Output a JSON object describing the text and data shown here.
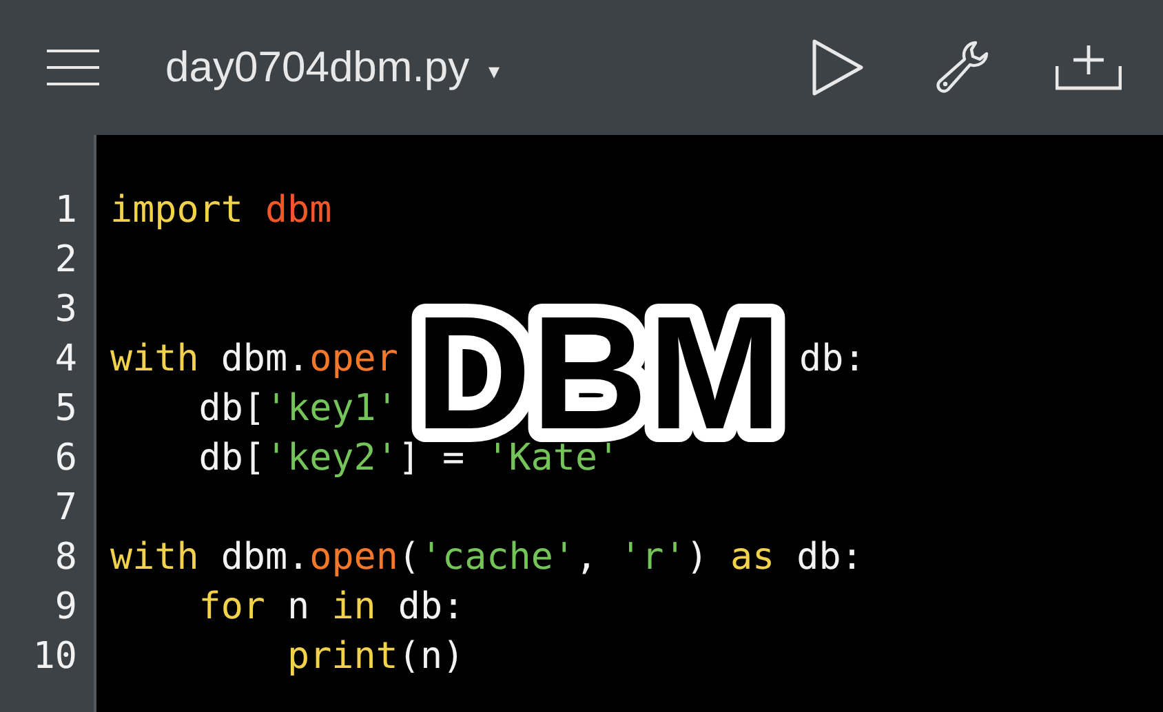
{
  "toolbar": {
    "file_name": "day0704dbm.py",
    "caret": "▾"
  },
  "editor": {
    "lines": [
      {
        "number": "1",
        "segments": [
          [
            {
              "kind": "keyword",
              "text": "import"
            },
            {
              "kind": "name",
              "text": " dbm"
            }
          ]
        ]
      },
      {
        "number": "2"
      },
      {
        "number": "3"
      },
      {
        "number": "4",
        "segments": [
          [
            {
              "kind": "keyword",
              "text": "with"
            },
            {
              "kind": "plain",
              "text": " dbm."
            },
            {
              "kind": "call",
              "text": "oper"
            }
          ],
          [
            {
              "kind": "plain",
              "text": "db:"
            }
          ]
        ]
      },
      {
        "number": "5",
        "segments": [
          [
            {
              "kind": "plain",
              "text": "    db["
            },
            {
              "kind": "string",
              "text": "'key1'"
            }
          ]
        ]
      },
      {
        "number": "6",
        "segments": [
          [
            {
              "kind": "plain",
              "text": "    db["
            },
            {
              "kind": "string",
              "text": "'key2'"
            },
            {
              "kind": "plain",
              "text": "] = "
            },
            {
              "kind": "string",
              "text": "'Kate'"
            }
          ]
        ]
      },
      {
        "number": "7"
      },
      {
        "number": "8",
        "segments": [
          [
            {
              "kind": "keyword",
              "text": "with"
            },
            {
              "kind": "plain",
              "text": " dbm."
            },
            {
              "kind": "call",
              "text": "open"
            },
            {
              "kind": "plain",
              "text": "("
            },
            {
              "kind": "string",
              "text": "'cache'"
            },
            {
              "kind": "plain",
              "text": ", "
            },
            {
              "kind": "string",
              "text": "'r'"
            },
            {
              "kind": "plain",
              "text": ") "
            },
            {
              "kind": "keyword",
              "text": "as"
            },
            {
              "kind": "plain",
              "text": " db:"
            }
          ]
        ]
      },
      {
        "number": "9",
        "segments": [
          [
            {
              "kind": "keyword",
              "text": "    for"
            },
            {
              "kind": "plain",
              "text": " n "
            },
            {
              "kind": "keyword",
              "text": "in"
            },
            {
              "kind": "plain",
              "text": " db:"
            }
          ]
        ]
      },
      {
        "number": "10",
        "segments": [
          [
            {
              "kind": "builtin",
              "text": "        print"
            },
            {
              "kind": "plain",
              "text": "(n)"
            }
          ]
        ]
      }
    ]
  },
  "overlay_title": "DBM"
}
